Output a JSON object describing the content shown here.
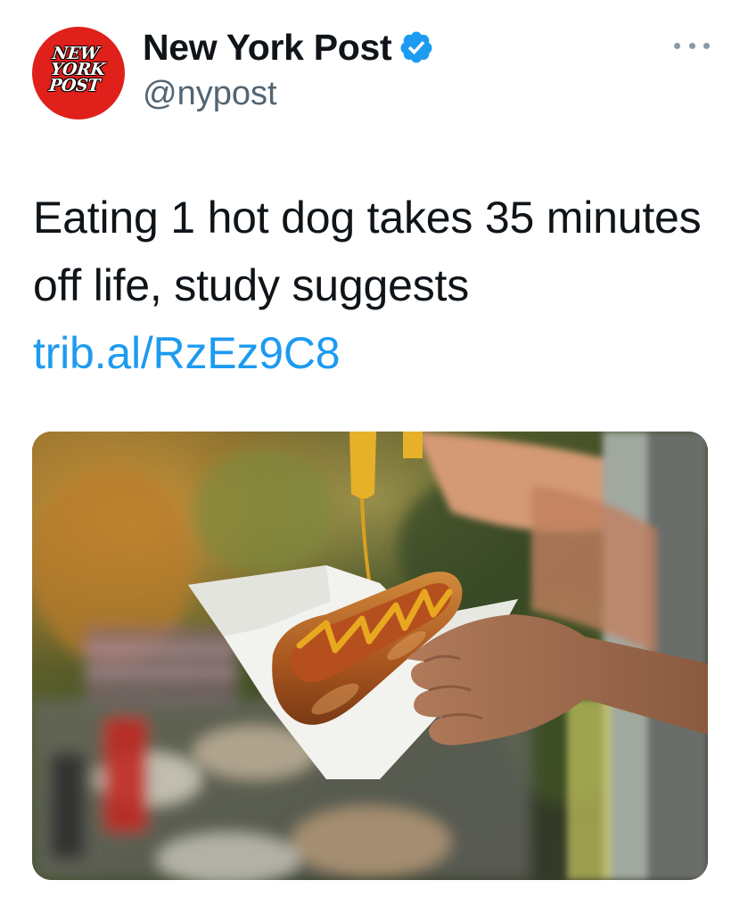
{
  "account": {
    "display_name": "New York Post",
    "handle": "@nypost",
    "avatar_logo_text": "NEW YORK POST",
    "verified": true,
    "avatar_color": "#e0201b",
    "verified_color": "#1d9bf0"
  },
  "tweet": {
    "text": "Eating 1 hot dog takes 35 minutes off life, study suggests ",
    "link_text": "trib.al/RzEz9C8",
    "link_color": "#1d9bf0"
  },
  "media": {
    "icon": "photo-of-hot-dog-with-mustard"
  },
  "icons": {
    "more": "more-options-icon",
    "verified": "verified-badge-icon"
  }
}
